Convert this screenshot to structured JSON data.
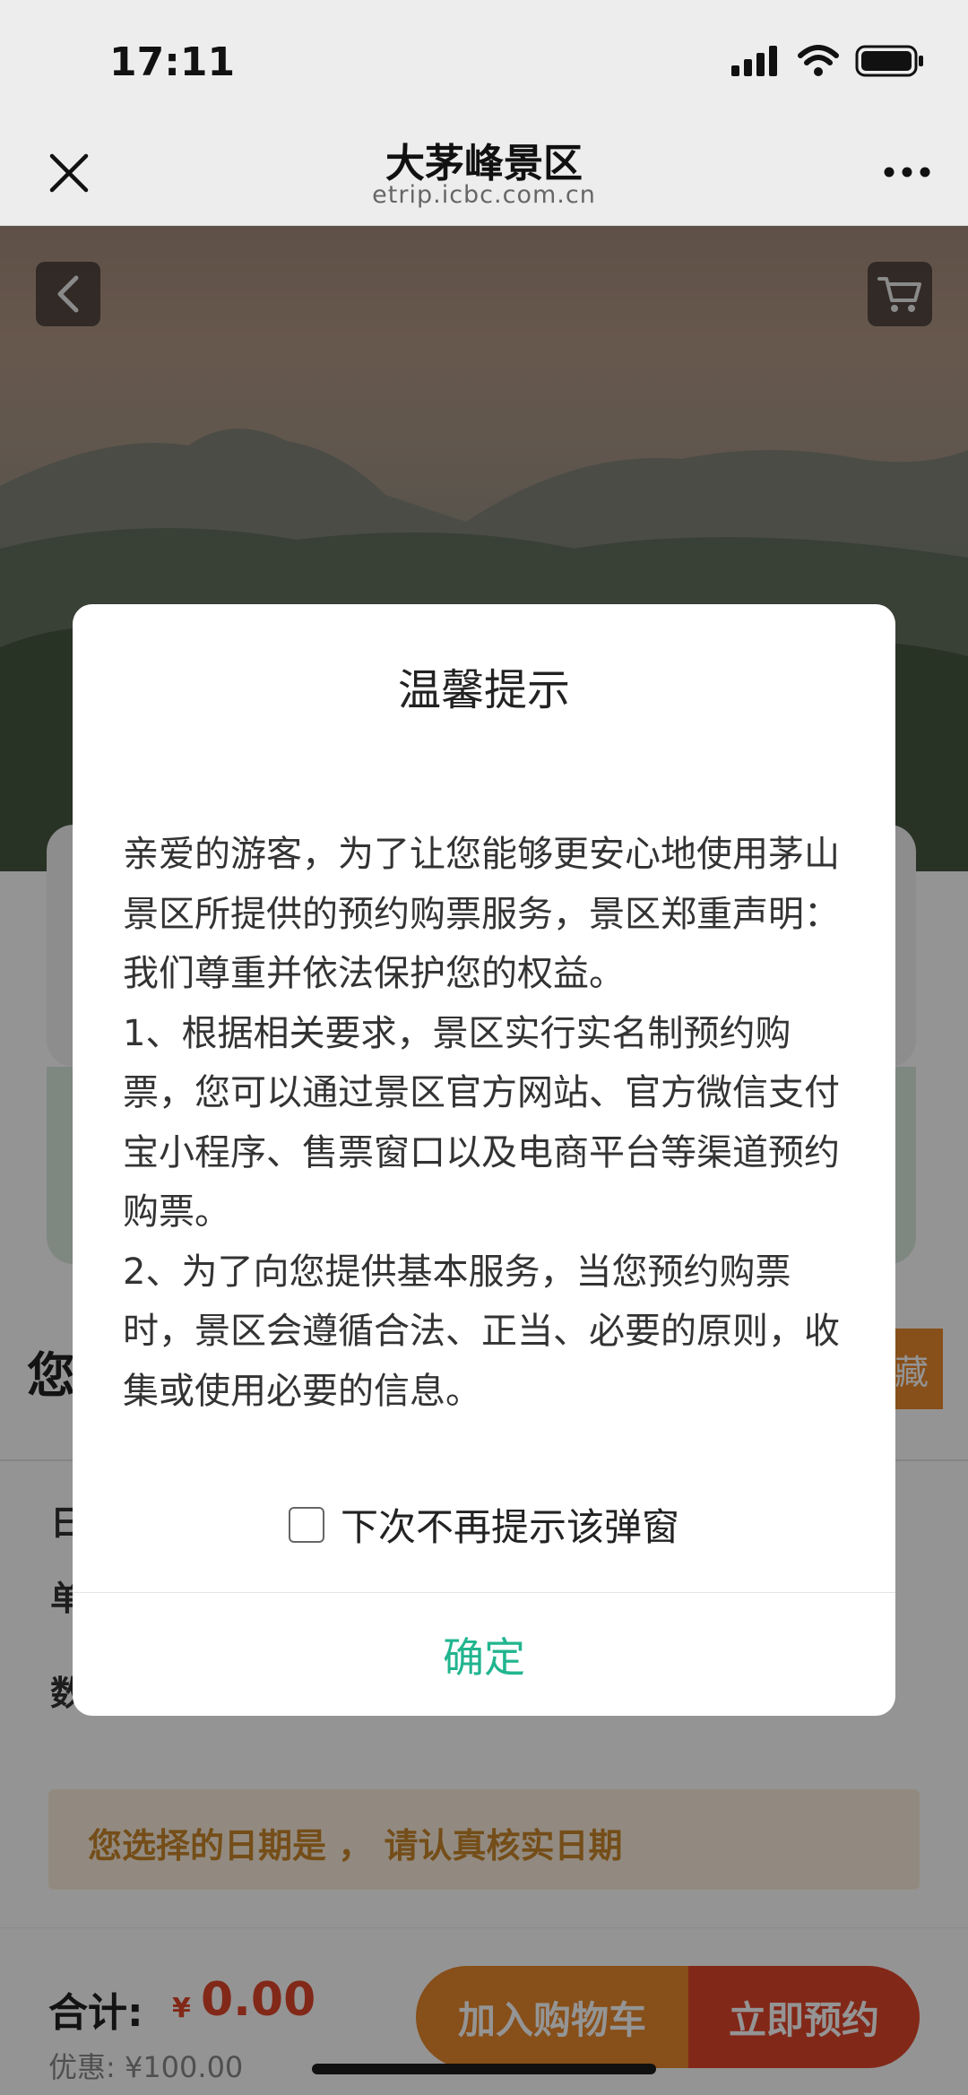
{
  "status_bar": {
    "time": "17:11"
  },
  "navbar": {
    "title": "大茅峰景区",
    "subtitle": "etrip.icbc.com.cn"
  },
  "icons": {
    "close": "close-icon",
    "more": "more-dots-icon",
    "back": "chevron-left-icon",
    "cart": "cart-icon",
    "signal": "signal-icon",
    "wifi": "wifi-icon",
    "battery": "battery-icon"
  },
  "page": {
    "you_partial": "您",
    "favorite_partial": "藏",
    "row_chars": [
      "日",
      "单",
      "数"
    ],
    "notice": "您选择的日期是 ， 请认真核实日期"
  },
  "bottom_bar": {
    "total_label": "合计:",
    "currency": "¥",
    "total_value": "0.00",
    "discount": "优惠: ¥100.00",
    "add_cart_label": "加入购物车",
    "book_now_label": "立即预约"
  },
  "dialog": {
    "title": "温馨提示",
    "paragraphs": [
      "亲爱的游客，为了让您能够更安心地使用茅山景区所提供的预约购票服务，景区郑重声明：我们尊重并依法保护您的权益。",
      "1、根据相关要求，景区实行实名制预约购票，您可以通过景区官方网站、官方微信支付宝小程序、售票窗口以及电商平台等渠道预约购票。",
      "2、为了向您提供基本服务，当您预约购票时，景区会遵循合法、正当、必要的原则，收集或使用必要的信息。"
    ],
    "checkbox_label": "下次不再提示该弹窗",
    "confirm_label": "确定"
  },
  "colors": {
    "accent_green": "#21b58f",
    "orange": "#e8892b",
    "red": "#e0462a"
  }
}
